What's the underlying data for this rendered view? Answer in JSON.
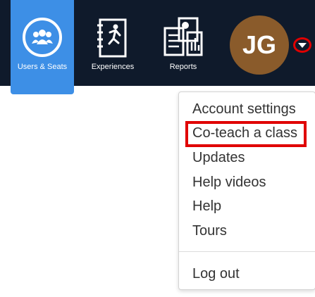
{
  "nav": {
    "users_label": "Users & Seats",
    "experiences_label": "Experiences",
    "reports_label": "Reports"
  },
  "user": {
    "initials": "JG"
  },
  "menu": {
    "account_settings": "Account settings",
    "coteach": "Co-teach a class",
    "updates": "Updates",
    "help_videos": "Help videos",
    "help": "Help",
    "tours": "Tours",
    "logout": "Log out"
  },
  "colors": {
    "topbar": "#0f1a2b",
    "active_nav": "#3d8fe6",
    "avatar": "#8a5b2b",
    "highlight": "#e00000"
  },
  "icons": [
    "users-icon",
    "experiences-icon",
    "reports-icon",
    "chevron-down-icon"
  ]
}
